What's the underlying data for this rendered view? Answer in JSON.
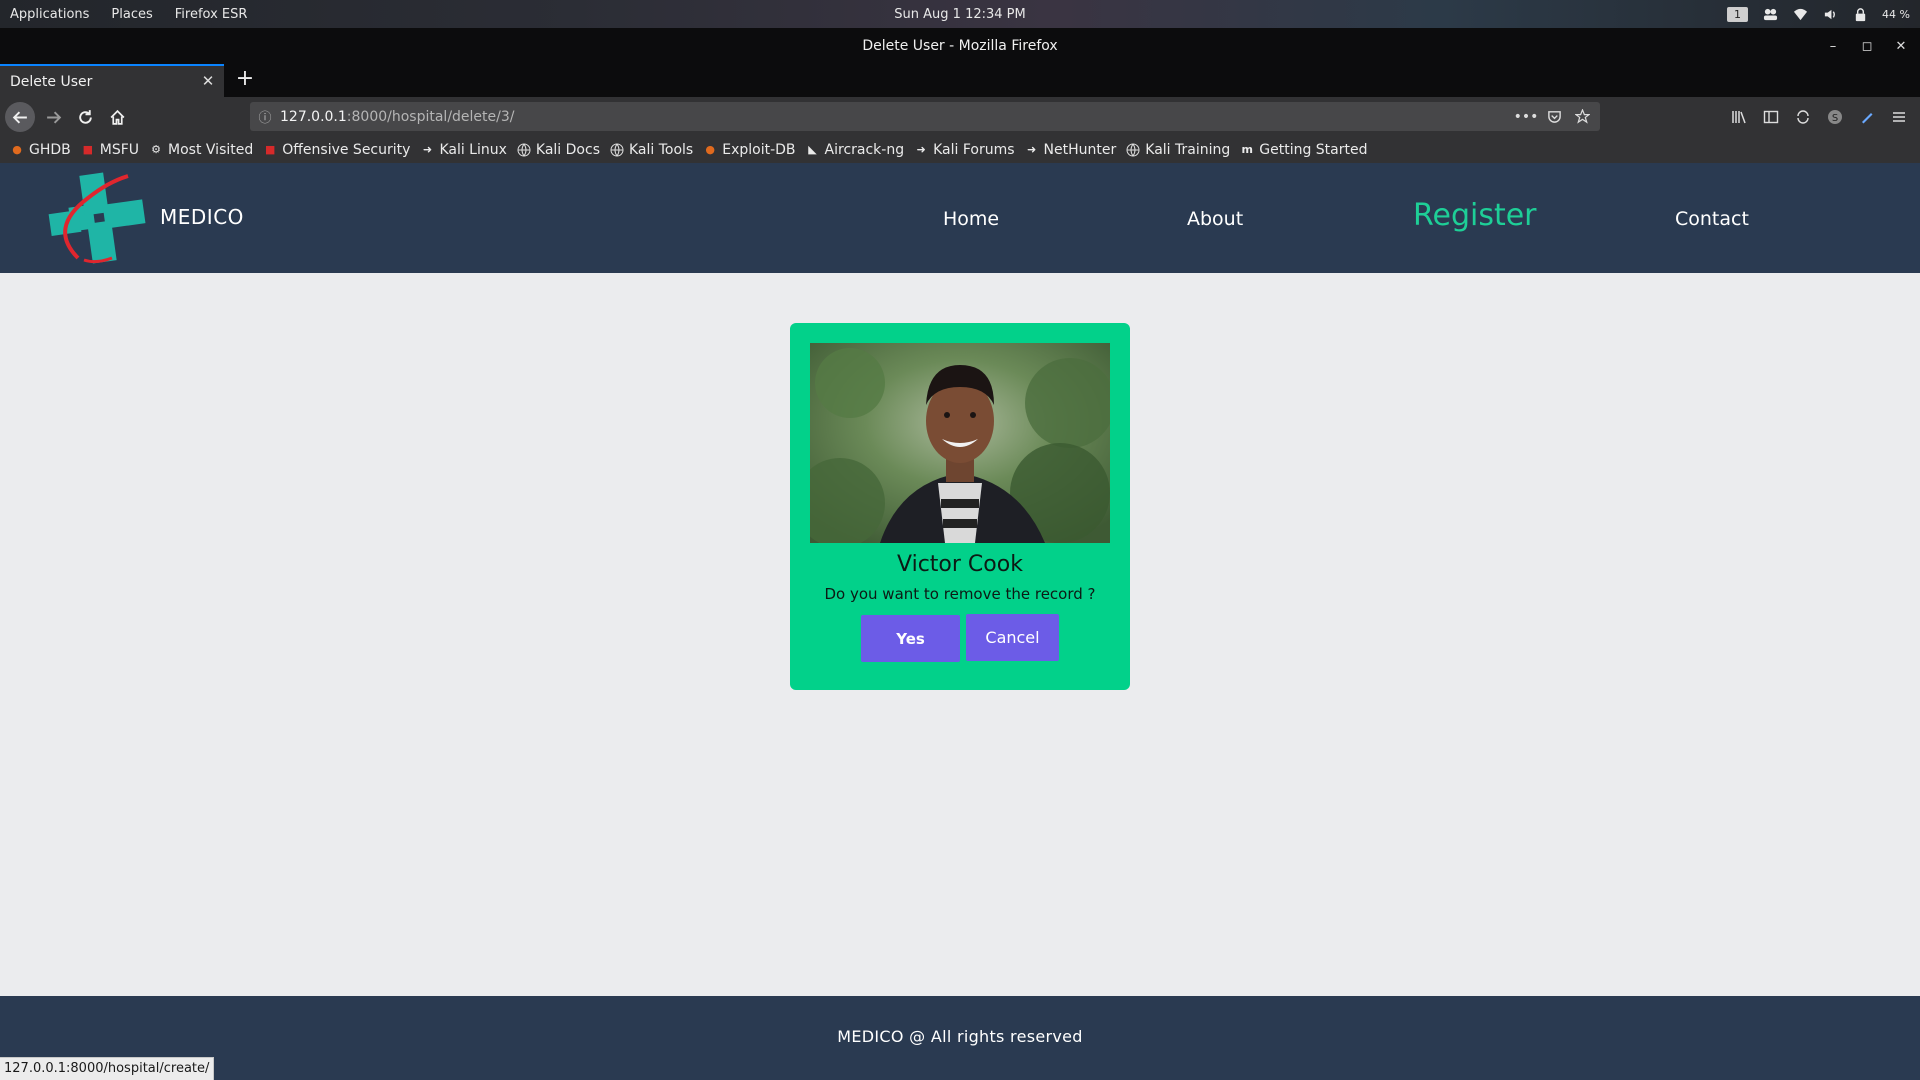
{
  "desktop": {
    "menu_items": [
      "Applications",
      "Places",
      "Firefox ESR"
    ],
    "clock": "Sun Aug 1  12:34 PM",
    "workspace": "1",
    "battery": "44 %"
  },
  "window": {
    "title": "Delete User - Mozilla Firefox"
  },
  "tabs": [
    {
      "label": "Delete User",
      "active": true
    }
  ],
  "urlbar": {
    "host": "127.0.0.1",
    "path": ":8000/hospital/delete/3/"
  },
  "bookmarks": [
    {
      "label": "GHDB",
      "icon": "ghdb-icon"
    },
    {
      "label": "MSFU",
      "icon": "msfu-icon"
    },
    {
      "label": "Most Visited",
      "icon": "gear-icon"
    },
    {
      "label": "Offensive Security",
      "icon": "offsec-icon"
    },
    {
      "label": "Kali Linux",
      "icon": "kali-icon"
    },
    {
      "label": "Kali Docs",
      "icon": "globe-icon"
    },
    {
      "label": "Kali Tools",
      "icon": "globe-icon"
    },
    {
      "label": "Exploit-DB",
      "icon": "exploitdb-icon"
    },
    {
      "label": "Aircrack-ng",
      "icon": "aircrack-icon"
    },
    {
      "label": "Kali Forums",
      "icon": "kali-icon"
    },
    {
      "label": "NetHunter",
      "icon": "kali-icon"
    },
    {
      "label": "Kali Training",
      "icon": "globe-icon"
    },
    {
      "label": "Getting Started",
      "icon": "m-icon"
    }
  ],
  "site": {
    "brand": "MEDICO",
    "nav": [
      {
        "label": "Home",
        "active": false
      },
      {
        "label": "About",
        "active": false
      },
      {
        "label": "Register",
        "active": true
      },
      {
        "label": "Contact",
        "active": false
      }
    ],
    "accent_color": "#1ecf97",
    "header_color": "#2a3a51"
  },
  "dialog": {
    "name": "Victor Cook",
    "message": "Do you want to remove the record ?",
    "yes_label": "Yes",
    "cancel_label": "Cancel",
    "card_color": "#02d18a",
    "button_color": "#6c5ce7"
  },
  "footer": {
    "text": "MEDICO @ All rights reserved"
  },
  "status": {
    "link_preview": "127.0.0.1:8000/hospital/create/"
  }
}
